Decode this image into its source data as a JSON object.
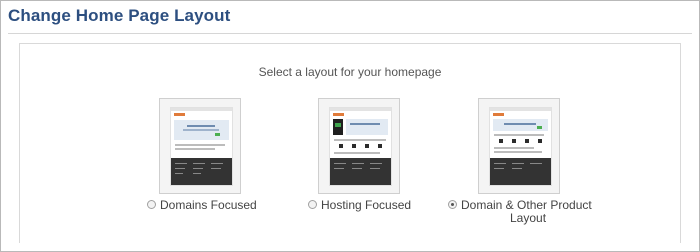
{
  "page": {
    "title": "Change Home Page Layout",
    "prompt": "Select a layout for your homepage"
  },
  "layouts": [
    {
      "label": "Domains Focused",
      "selected": false
    },
    {
      "label": "Hosting Focused",
      "selected": false
    },
    {
      "label": "Domain & Other Product Layout",
      "label_line1": "Domain & Other Product",
      "label_line2": "Layout",
      "selected": true
    }
  ]
}
